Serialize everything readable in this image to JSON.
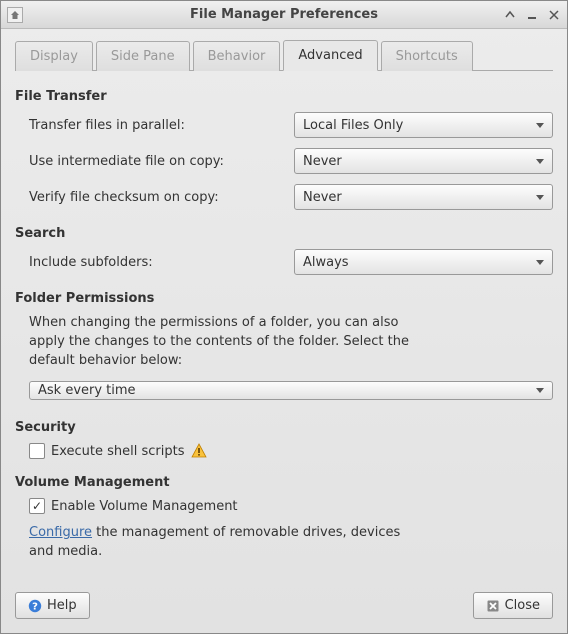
{
  "window": {
    "title": "File Manager Preferences"
  },
  "tabs": {
    "display": "Display",
    "side_pane": "Side Pane",
    "behavior": "Behavior",
    "advanced": "Advanced",
    "shortcuts": "Shortcuts"
  },
  "file_transfer": {
    "title": "File Transfer",
    "parallel_label": "Transfer files in parallel:",
    "parallel_value": "Local Files Only",
    "intermediate_label": "Use intermediate file on copy:",
    "intermediate_value": "Never",
    "checksum_label": "Verify file checksum on copy:",
    "checksum_value": "Never"
  },
  "search": {
    "title": "Search",
    "subfolders_label": "Include subfolders:",
    "subfolders_value": "Always"
  },
  "folder_perms": {
    "title": "Folder Permissions",
    "desc": "When changing the permissions of a folder, you can also apply the changes to the contents of the folder. Select the default behavior below:",
    "value": "Ask every time"
  },
  "security": {
    "title": "Security",
    "exec_label": "Execute shell scripts"
  },
  "volume": {
    "title": "Volume Management",
    "enable_label": "Enable Volume Management",
    "configure_link": "Configure",
    "configure_rest": " the management of removable drives, devices and media."
  },
  "buttons": {
    "help": "Help",
    "close": "Close"
  }
}
